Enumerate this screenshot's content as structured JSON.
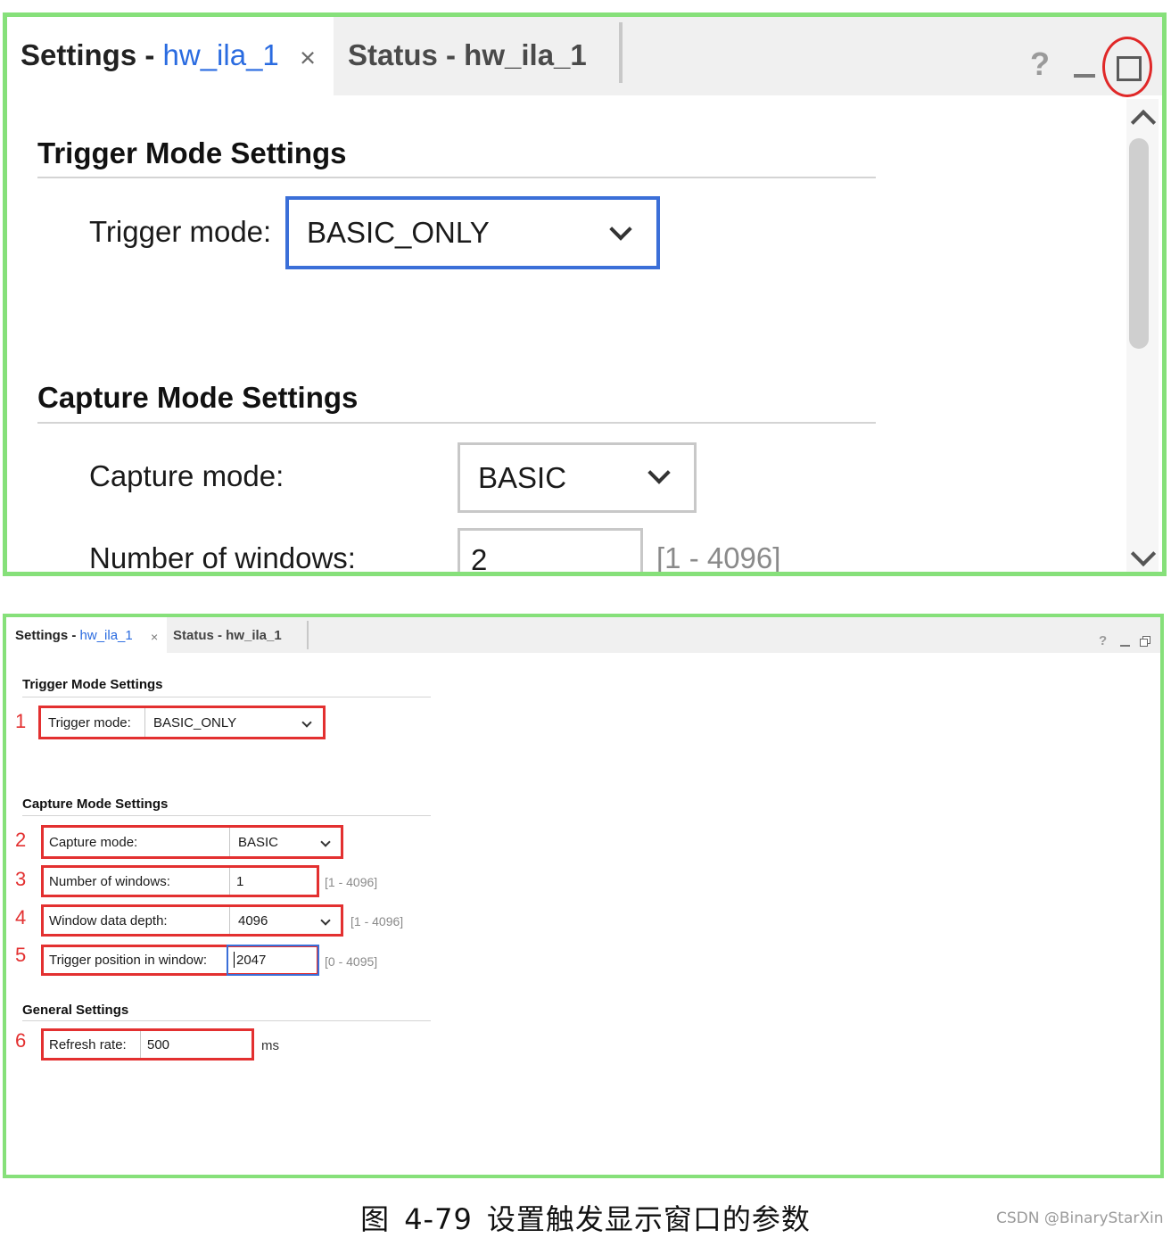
{
  "tabs": {
    "settings_prefix": "Settings - ",
    "settings_target": "hw_ila_1",
    "close_glyph": "×",
    "status_label": "Status - hw_ila_1"
  },
  "window_controls": {
    "help": "?",
    "minimize_icon": "minimize-icon",
    "maximize_icon": "maximize-icon",
    "restore_icon": "restore-icon"
  },
  "zoom_panel": {
    "trigger_section": "Trigger Mode Settings",
    "trigger_mode_label": "Trigger mode:",
    "trigger_mode_value": "BASIC_ONLY",
    "capture_section": "Capture Mode Settings",
    "capture_mode_label": "Capture mode:",
    "capture_mode_value": "BASIC",
    "windows_label": "Number of windows:",
    "windows_value": "2",
    "windows_range": "[1 - 4096]"
  },
  "full_panel": {
    "trigger_section": "Trigger Mode Settings",
    "capture_section": "Capture Mode Settings",
    "general_section": "General Settings",
    "fields": [
      {
        "num": "1",
        "label": "Trigger mode:",
        "value": "BASIC_ONLY",
        "range": ""
      },
      {
        "num": "2",
        "label": "Capture mode:",
        "value": "BASIC",
        "range": ""
      },
      {
        "num": "3",
        "label": "Number of windows:",
        "value": "1",
        "range": "[1 - 4096]"
      },
      {
        "num": "4",
        "label": "Window data depth:",
        "value": "4096",
        "range": "[1 - 4096]"
      },
      {
        "num": "5",
        "label": "Trigger position in window:",
        "value": "2047",
        "range": "[0 - 4095]"
      },
      {
        "num": "6",
        "label": "Refresh rate:",
        "value": "500",
        "range": ""
      }
    ],
    "refresh_unit": "ms"
  },
  "caption": {
    "prefix": "图",
    "number": "4-79",
    "text": "设置触发显示窗口的参数"
  },
  "watermark": "CSDN @BinaryStarXin",
  "colors": {
    "panel_border": "#86e07a",
    "annotation_red": "#e33030",
    "focus_blue": "#3b6fd8",
    "link_blue": "#2a6be0"
  }
}
